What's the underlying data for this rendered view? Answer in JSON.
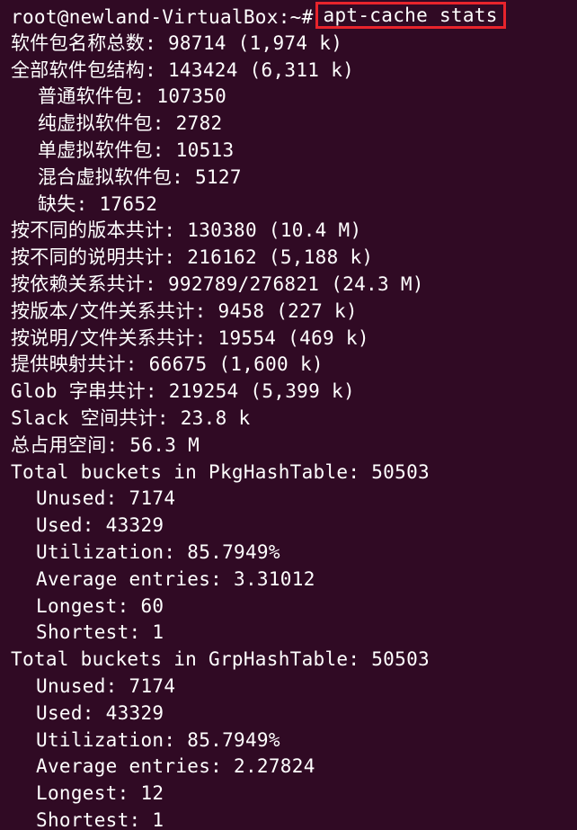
{
  "terminal": {
    "prompt": "root@newland-VirtualBox:~#",
    "command": "apt-cache stats",
    "lines": [
      "软件包名称总数: 98714 (1,974 k)",
      "全部软件包结构: 143424 (6,311 k)",
      "普通软件包: 107350",
      "纯虚拟软件包: 2782",
      "单虚拟软件包: 10513",
      "混合虚拟软件包: 5127",
      "缺失: 17652",
      "按不同的版本共计: 130380 (10.4 M)",
      "按不同的说明共计: 216162 (5,188 k)",
      "按依赖关系共计: 992789/276821 (24.3 M)",
      "按版本/文件关系共计: 9458 (227 k)",
      "按说明/文件关系共计: 19554 (469 k)",
      "提供映射共计: 66675 (1,600 k)",
      "Glob 字串共计: 219254 (5,399 k)",
      "Slack 空间共计: 23.8 k",
      "总占用空间: 56.3 M",
      "Total buckets in PkgHashTable: 50503",
      "Unused: 7174",
      "Used: 43329",
      "Utilization: 85.7949%",
      "Average entries: 3.31012",
      "Longest: 60",
      "Shortest: 1",
      "Total buckets in GrpHashTable: 50503",
      "Unused: 7174",
      "Used: 43329",
      "Utilization: 85.7949%",
      "Average entries: 2.27824",
      "Longest: 12",
      "Shortest: 1"
    ]
  },
  "colors": {
    "background": "#300a24",
    "text": "#ffffff",
    "highlight_box": "#e8242c"
  }
}
